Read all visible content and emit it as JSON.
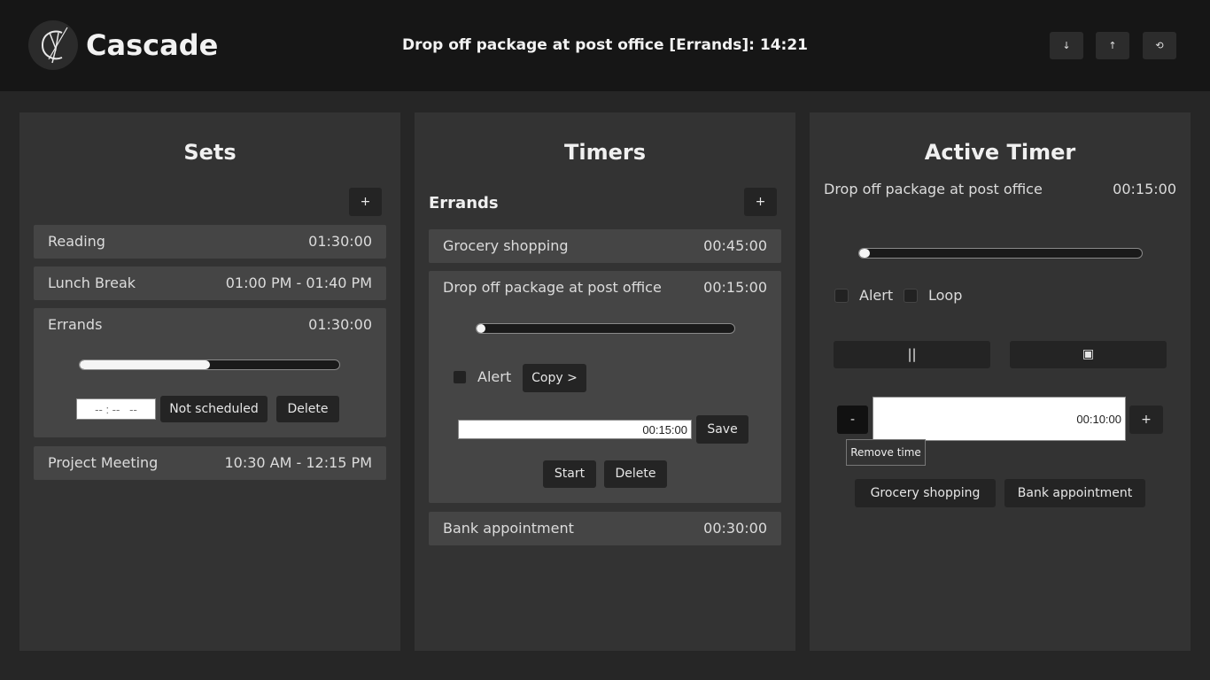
{
  "header": {
    "app_title": "Cascade",
    "current_timer": "Drop off package at post office [Errands]: 14:21",
    "buttons": [
      "↓",
      "↑",
      "⟲"
    ]
  },
  "sets": {
    "title": "Sets",
    "add_label": "+",
    "items": [
      {
        "name": "Reading",
        "time": "01:30:00"
      },
      {
        "name": "Lunch Break",
        "time": "01:00 PM - 01:40 PM"
      },
      {
        "name": "Errands",
        "time": "01:30:00",
        "progress": 0.5
      },
      {
        "name": "Project Meeting",
        "time": "10:30 AM - 12:15 PM"
      }
    ],
    "time_input_placeholder": "-- : --   --",
    "not_scheduled_label": "Not scheduled",
    "delete_label": "Delete"
  },
  "timers": {
    "title": "Timers",
    "set_name": "Errands",
    "add_label": "+",
    "items": [
      {
        "name": "Grocery shopping",
        "time": "00:45:00"
      },
      {
        "name": "Drop off package at post office",
        "time": "00:15:00",
        "progress": 0.02
      },
      {
        "name": "Bank appointment",
        "time": "00:30:00"
      }
    ],
    "alert_label": "Alert",
    "copy_label": "Copy >",
    "duration_value": "00:15:00",
    "save_label": "Save",
    "start_label": "Start",
    "delete_label": "Delete"
  },
  "active": {
    "title": "Active Timer",
    "timer_name": "Drop off package at post office",
    "timer_time": "00:15:00",
    "progress": 0.03,
    "alert_label": "Alert",
    "loop_label": "Loop",
    "pause_label": "||",
    "stop_label": "▣",
    "minus_label": "-",
    "adjust_value": "00:10:00",
    "plus_label": "+",
    "tooltip": "Remove time",
    "next_timers": [
      "Grocery shopping",
      "Bank appointment"
    ]
  }
}
